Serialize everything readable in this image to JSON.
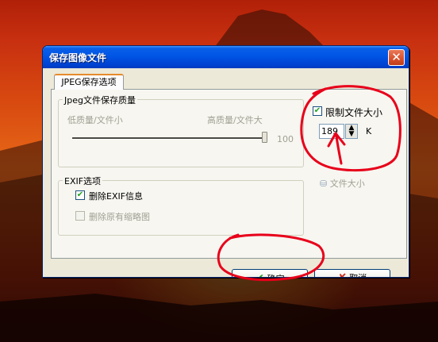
{
  "window": {
    "title": "保存图像文件"
  },
  "tab": {
    "label": "JPEG保存选项"
  },
  "quality": {
    "group_title": "Jpeg文件保存质量",
    "low_label": "低质量/文件小",
    "high_label": "高质量/文件大",
    "value": "100",
    "fraction": 1.0
  },
  "exif": {
    "group_title": "EXIF选项",
    "delete_exif_label": "删除EXIF信息",
    "delete_exif_checked": true,
    "delete_thumb_label": "删除原有缩略图",
    "delete_thumb_checked": false
  },
  "limit": {
    "label": "限制文件大小",
    "checked": true,
    "size_value": "189",
    "unit": "K",
    "filesize_button": "文件大小"
  },
  "buttons": {
    "ok": "确定",
    "cancel": "取消"
  },
  "colors": {
    "annotation": "#e8001a",
    "titlebar": "#0055e5",
    "accent_tab": "#e68b2c"
  }
}
